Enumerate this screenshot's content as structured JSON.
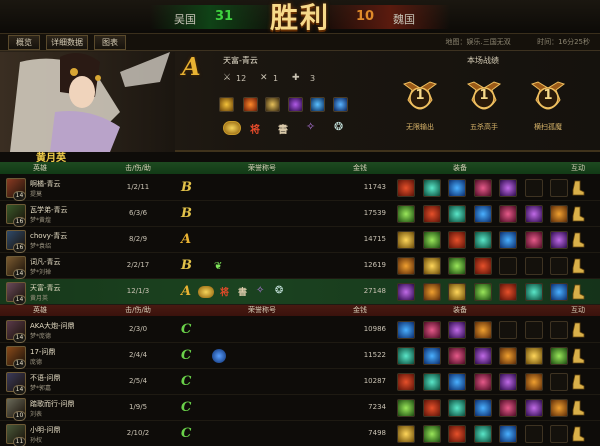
{
  "topbar": {
    "team_left": "吴国",
    "score_left": "31",
    "victory_text": "胜利",
    "score_right": "10",
    "team_right": "魏国",
    "colors": {
      "left_score": "#3fd13f",
      "right_score": "#e08a2a"
    }
  },
  "tabs": [
    "概览",
    "详细数据",
    "图表"
  ],
  "meta": {
    "map": "地图：娱乐.三国无双",
    "time": "时间：16分25秒"
  },
  "hero": {
    "rating": "A",
    "name": "天富-青云",
    "stats": [
      "12",
      "1",
      "3"
    ],
    "battle_header": "本场战绩",
    "medals": [
      {
        "digit": "1",
        "label": "无限输出"
      },
      {
        "digit": "1",
        "label": "五杀高手"
      },
      {
        "digit": "1",
        "label": "横扫孤魔"
      }
    ]
  },
  "section_title": "黄月英",
  "headers": {
    "hero": "英雄",
    "kda": "击/伤/助",
    "honor": "荣誉称号",
    "gold": "金钱",
    "equip": "装备",
    "interact": "互动"
  },
  "team_wu": [
    {
      "name": "啊橘-青云",
      "id": "提莫",
      "level": "14",
      "kda": "1/2/11",
      "honor": "B",
      "gold": "11743",
      "avatar": "#8a3a22"
    },
    {
      "name": "瓦学弟-青云",
      "id": "梦*黄煌",
      "level": "16",
      "kda": "6/3/6",
      "honor": "B",
      "gold": "17539",
      "avatar": "#3a5a2a"
    },
    {
      "name": "chovy-青云",
      "id": "梦*袁绍",
      "level": "16",
      "kda": "8/2/9",
      "honor": "A",
      "gold": "14715",
      "avatar": "#2f4a6a"
    },
    {
      "name": "词凡-青云",
      "id": "梦*刘禅",
      "level": "14",
      "kda": "2/2/17",
      "honor": "B",
      "gold": "12619",
      "avatar": "#7a5a30"
    },
    {
      "name": "天富-青云",
      "id": "黄月英",
      "level": "14",
      "kda": "12/1/3",
      "honor": "A",
      "gold": "27148",
      "avatar": "#6a4a5a"
    }
  ],
  "team_wei": [
    {
      "name": "AKA大炮-问鼎",
      "id": "梦*庞德",
      "level": "14",
      "kda": "2/3/0",
      "honor": "C",
      "gold": "10986",
      "avatar": "#5a3a4a"
    },
    {
      "name": "17-问鼎",
      "id": "庞德",
      "level": "14",
      "kda": "2/4/4",
      "honor": "C",
      "gold": "11522",
      "avatar": "#8a4a1a"
    },
    {
      "name": "不语-问鼎",
      "id": "梦*郭嘉",
      "level": "14",
      "kda": "2/5/4",
      "honor": "C",
      "gold": "10287",
      "avatar": "#3a3a5a"
    },
    {
      "name": "踏歌而行-问鼎",
      "id": "刘表",
      "level": "10",
      "kda": "1/9/5",
      "honor": "C",
      "gold": "7234",
      "avatar": "#6a6a5a"
    },
    {
      "name": "小明-问鼎",
      "id": "孙权",
      "level": "11",
      "kda": "2/10/2",
      "honor": "C",
      "gold": "7498",
      "avatar": "#4a5a3a"
    }
  ]
}
